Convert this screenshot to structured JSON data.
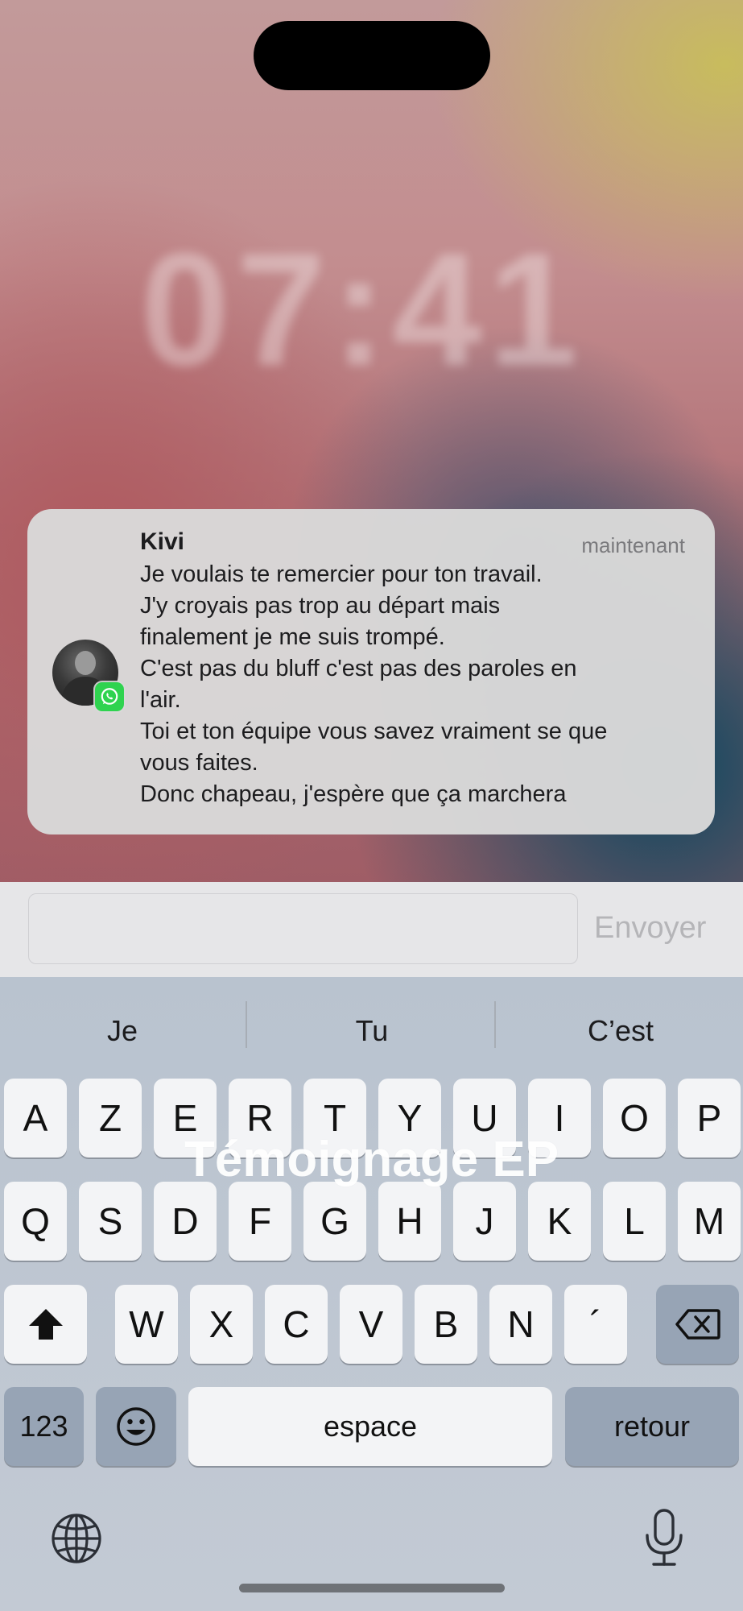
{
  "lockscreen": {
    "clock_text": "07:41"
  },
  "notification": {
    "sender": "Kivi",
    "time": "maintenant",
    "app_icon": "whatsapp-icon",
    "body_lines": [
      "Je voulais te remercier pour ton travail.",
      "J'y croyais pas trop au départ mais",
      "finalement je me suis trompé.",
      "C'est pas du bluff c'est pas des paroles en",
      "l'air.",
      "Toi et ton équipe vous savez vraiment se que",
      "vous faites.",
      "Donc chapeau, j'espère que ça marchera"
    ]
  },
  "reply": {
    "placeholder": "",
    "send_label": "Envoyer"
  },
  "keyboard": {
    "suggestions": [
      "Je",
      "Tu",
      "C’est"
    ],
    "row1": [
      "A",
      "Z",
      "E",
      "R",
      "T",
      "Y",
      "U",
      "I",
      "O",
      "P"
    ],
    "row2": [
      "Q",
      "S",
      "D",
      "F",
      "G",
      "H",
      "J",
      "K",
      "L",
      "M"
    ],
    "row3": [
      "W",
      "X",
      "C",
      "V",
      "B",
      "N",
      "´"
    ],
    "numbers_label": "123",
    "space_label": "espace",
    "return_label": "retour"
  },
  "overlay_caption": "Témoignage EP",
  "colors": {
    "whatsapp_green": "#2fd34f",
    "send_disabled": "#b5b5b8"
  }
}
